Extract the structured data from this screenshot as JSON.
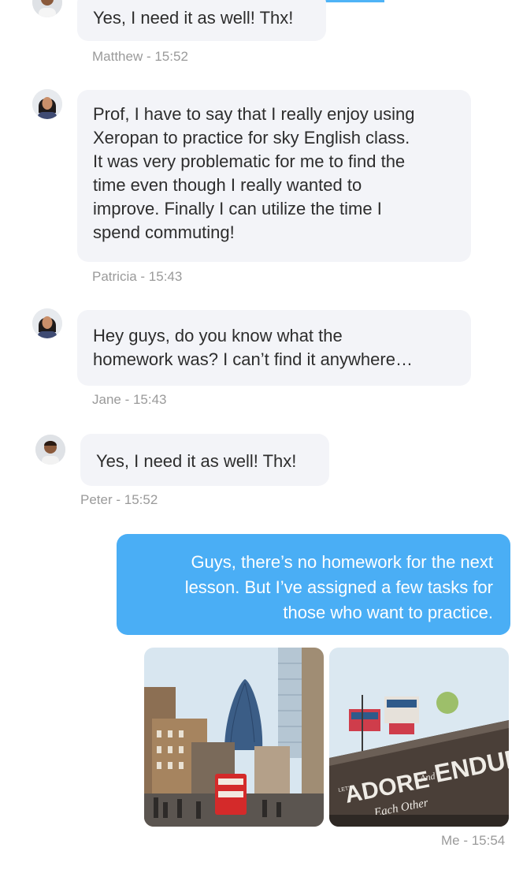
{
  "messages": [
    {
      "text": "Yes, I need it as well! Thx!",
      "meta": "Matthew - 15:52"
    },
    {
      "lines": [
        "Prof, I have to say that I really enjoy using",
        "Xeropan to practice for sky English class.",
        "It was very problematic for me to find the",
        "time even though I really wanted to",
        "improve. Finally I can utilize the time I",
        "spend commuting!"
      ],
      "meta": "Patricia - 15:43"
    },
    {
      "lines": [
        "Hey guys, do you know what the",
        "homework was? I can’t find it anywhere…"
      ],
      "meta": "Jane - 15:43"
    },
    {
      "text": "Yes, I need it as well! Thx!",
      "meta": "Peter - 15:52"
    }
  ],
  "my_message": {
    "lines": [
      "Guys, there’s no homework for the next",
      "lesson. But I’ve assigned a few tasks for",
      "those who want to practice."
    ],
    "meta": "Me - 15:54"
  },
  "photo2_sign": {
    "top": "LET'S",
    "main": "ADORE",
    "and": "And",
    "right": "ENDUR",
    "sub": "Each Other"
  },
  "colors": {
    "accent": "#4aaef5",
    "bubble": "#f3f4f8",
    "meta": "#9a9a9a"
  }
}
